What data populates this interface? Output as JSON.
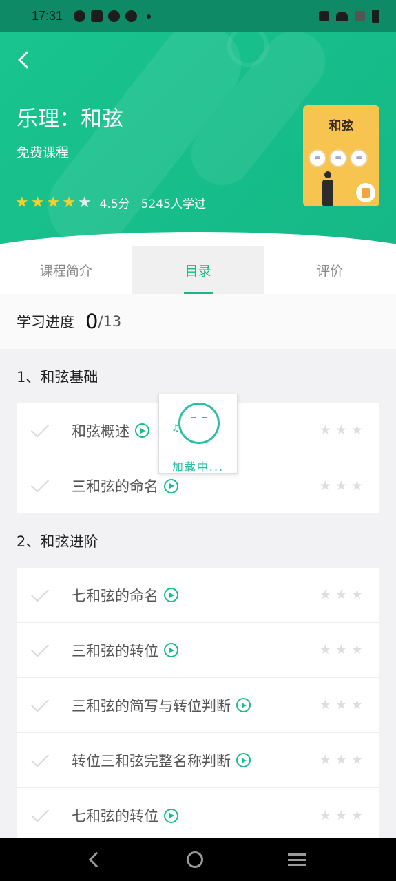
{
  "status": {
    "time": "17:31"
  },
  "header": {
    "title": "乐理：和弦",
    "subtitle": "免费课程",
    "rating_score": "4.5分",
    "learners": "5245人学过",
    "stars_filled": 4,
    "stars_total": 5,
    "cover_title": "和弦"
  },
  "tabs": [
    {
      "label": "课程简介",
      "active": false
    },
    {
      "label": "目录",
      "active": true
    },
    {
      "label": "评价",
      "active": false
    }
  ],
  "progress": {
    "label": "学习进度",
    "done": "0",
    "total": "/13"
  },
  "sections": [
    {
      "title": "1、和弦基础",
      "lessons": [
        {
          "name": "和弦概述"
        },
        {
          "name": "三和弦的命名"
        }
      ]
    },
    {
      "title": "2、和弦进阶",
      "lessons": [
        {
          "name": "七和弦的命名"
        },
        {
          "name": "三和弦的转位"
        },
        {
          "name": "三和弦的简写与转位判断"
        },
        {
          "name": "转位三和弦完整名称判断"
        },
        {
          "name": "七和弦的转位"
        }
      ]
    }
  ],
  "loading": {
    "text": "加载中..."
  },
  "colors": {
    "accent": "#16b985",
    "star": "#f9d12a"
  }
}
